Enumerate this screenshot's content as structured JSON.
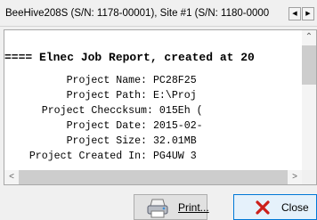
{
  "tab": {
    "title": "BeeHive208S (S/N: 1178-00001), Site #1 (S/N: 1180-0000",
    "scroll_left_icon": "triangle-left",
    "scroll_right_icon": "triangle-right"
  },
  "report": {
    "lines": [
      "==== Elnec Job Report, created at 20",
      "          Project Name: PC28F25",
      "          Project Path: E:\\Proj",
      "      Project Checcksum: 015Eh (",
      "          Project Date: 2015-02-",
      "          Project Size: 32.01MB",
      "    Project Created In: PG4UW 3"
    ]
  },
  "scrollbars": {
    "up_icon": "chevron-up",
    "left_icon": "chevron-left",
    "right_icon": "chevron-right"
  },
  "buttons": {
    "print_label": "Print...",
    "print_icon": "printer",
    "close_label": "Close",
    "close_icon": "red-x",
    "close_icon_color": "#cc1f1a"
  }
}
